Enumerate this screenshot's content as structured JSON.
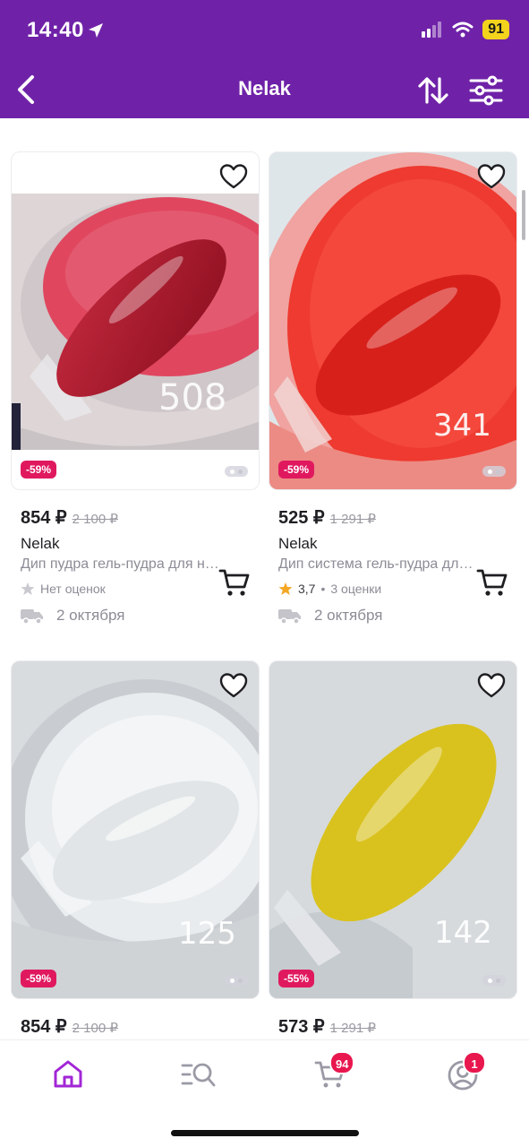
{
  "status": {
    "time": "14:40",
    "battery": "91"
  },
  "header": {
    "title": "Nelak"
  },
  "colors": {
    "brand": "#6f22a8",
    "discount": "#e0195f",
    "rating_star": "#f5a623"
  },
  "products": [
    {
      "price": "854 ₽",
      "old_price": "2 100 ₽",
      "discount": "-59%",
      "brand": "Nelak",
      "name": "Дип пудра гель-пудра для ногтей",
      "rating_value": "",
      "rating_text": "Нет оценок",
      "delivery": "2 октября",
      "photo_label": "508"
    },
    {
      "price": "525 ₽",
      "old_price": "1 291 ₽",
      "discount": "-59%",
      "brand": "Nelak",
      "name": "Дип система гель-пудра для ногтей",
      "rating_value": "3,7",
      "rating_text": "3 оценки",
      "delivery": "2 октября",
      "photo_label": "341"
    },
    {
      "price": "854 ₽",
      "old_price": "2 100 ₽",
      "discount": "-59%",
      "photo_label": "125"
    },
    {
      "price": "573 ₽",
      "old_price": "1 291 ₽",
      "discount": "-55%",
      "photo_label": "142"
    }
  ],
  "tabs": {
    "cart_badge": "94",
    "profile_badge": "1"
  }
}
